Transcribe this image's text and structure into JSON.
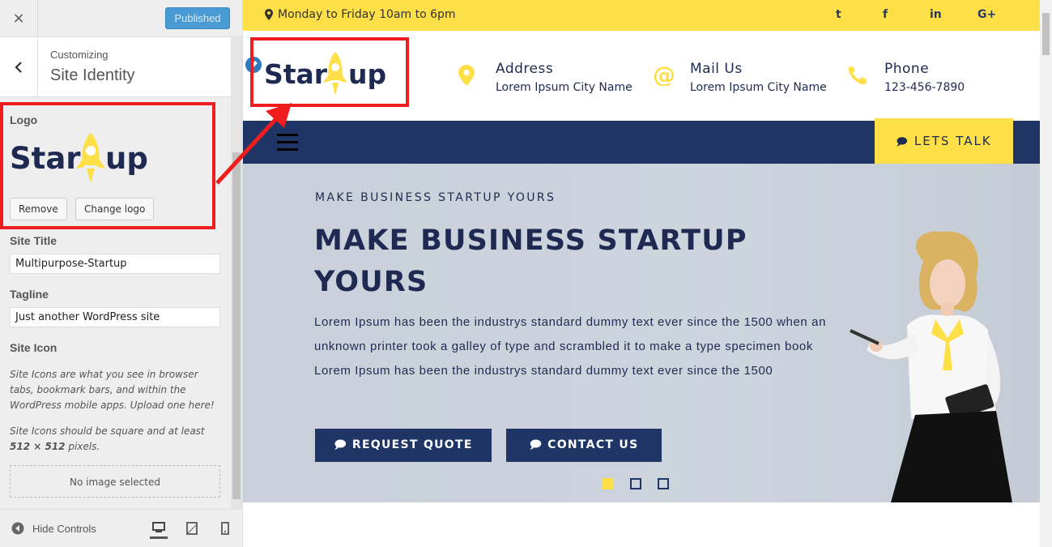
{
  "sidebar": {
    "close_label": "×",
    "publish_label": "Published",
    "customizing_label": "Customizing",
    "section_title": "Site Identity",
    "logo_label": "Logo",
    "logo_brand": "Startup",
    "remove_label": "Remove",
    "change_logo_label": "Change logo",
    "site_title_label": "Site Title",
    "site_title_value": "Multipurpose-Startup",
    "tagline_label": "Tagline",
    "tagline_value": "Just another WordPress site",
    "site_icon_label": "Site Icon",
    "site_icon_desc1": "Site Icons are what you see in browser tabs, bookmark bars, and within the WordPress mobile apps. Upload one here!",
    "site_icon_desc2_a": "Site Icons should be square and at least ",
    "site_icon_desc2_b": "512 × 512",
    "site_icon_desc2_c": " pixels.",
    "no_image_label": "No image selected",
    "hide_controls_label": "Hide Controls"
  },
  "preview": {
    "hours": "Monday to Friday 10am to 6pm",
    "social_icons": [
      "twitter-icon",
      "facebook-icon",
      "linkedin-icon",
      "google-plus-icon"
    ],
    "social": {
      "twitter": "t",
      "facebook": "f",
      "linkedin": "in",
      "google": "G+"
    },
    "logo_brand": "Startup",
    "address_title": "Address",
    "address_value": "Lorem Ipsum City Name",
    "mail_title": "Mail Us",
    "mail_value": "Lorem Ipsum City Name",
    "phone_title": "Phone",
    "phone_value": "123-456-7890",
    "lets_talk_label": "LETS TALK",
    "hero_eyebrow": "MAKE BUSINESS STARTUP YOURS",
    "hero_title": "MAKE BUSINESS STARTUP YOURS",
    "hero_text": "Lorem Ipsum has been the industrys standard dummy text ever since the 1500 when an unknown printer took a galley of type and scrambled it to make a type specimen book Lorem Ipsum has been the industrys standard dummy text ever since the 1500",
    "request_quote_label": "REQUEST QUOTE",
    "contact_us_label": "CONTACT US",
    "slider_dots": 3,
    "active_slide": 1
  },
  "colors": {
    "brand_navy": "#1f3566",
    "brand_yellow": "#fde047",
    "annotation_red": "#ef1d1d",
    "publish_blue": "#4a9ad3"
  }
}
